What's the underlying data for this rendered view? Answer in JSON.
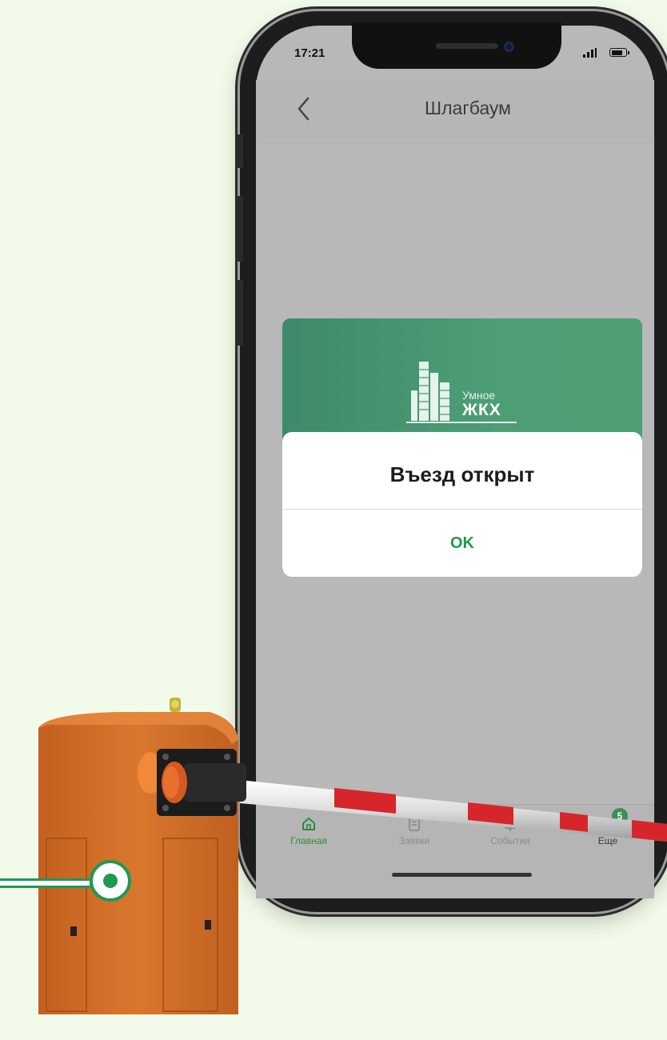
{
  "status_bar": {
    "time": "17:21"
  },
  "header": {
    "title": "Шлагбаум"
  },
  "banner": {
    "logo_line1": "Умное",
    "logo_line2": "ЖКХ"
  },
  "dialog": {
    "message": "Въезд открыт",
    "ok_label": "OK"
  },
  "tab_bar": {
    "tabs": [
      {
        "label": "Главная",
        "icon": "home-icon",
        "active": true
      },
      {
        "label": "Заявки",
        "icon": "requests-icon",
        "active": false
      },
      {
        "label": "События",
        "icon": "bell-icon",
        "active": false
      },
      {
        "label": "Еще",
        "icon": "more-icon",
        "active": false
      }
    ],
    "badge": "5"
  },
  "colors": {
    "accent": "#1f9a4a",
    "banner": "#4d9e75",
    "barrier": "#d4722b",
    "background": "#f2fbe9"
  }
}
